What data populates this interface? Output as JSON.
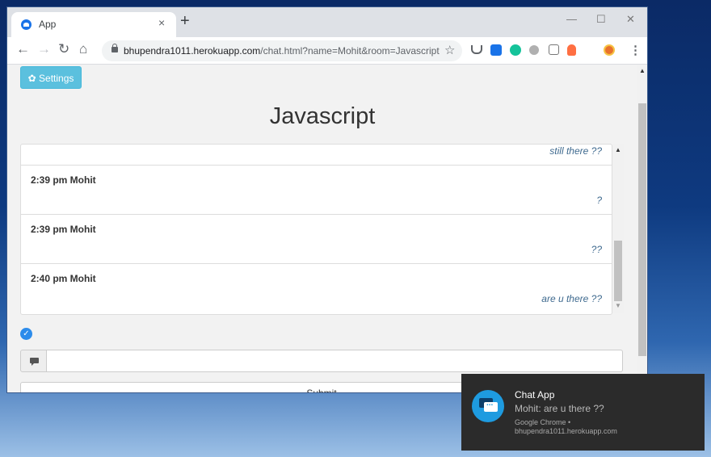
{
  "tab": {
    "title": "App",
    "close": "×",
    "new_tab": "+"
  },
  "window_controls": {
    "minimize": "—",
    "maximize": "☐",
    "close": "✕"
  },
  "toolbar": {
    "back": "←",
    "forward": "→",
    "reload": "↻",
    "home": "⌂",
    "url_domain": "bhupendra1011.herokuapp.com",
    "url_path": "/chat.html?name=Mohit&room=Javascript",
    "star": "☆",
    "menu": "⋮",
    "extensions": [
      "pocket-icon",
      "window-icon",
      "grammarly-icon",
      "settings-ext-icon",
      "translate-icon",
      "ghostery-icon",
      "profile-avatar"
    ]
  },
  "page": {
    "settings_label": "Settings",
    "room_title": "Javascript",
    "messages": [
      {
        "meta": "",
        "text": "still there ??"
      },
      {
        "meta": "2:39 pm Mohit",
        "text": "?"
      },
      {
        "meta": "2:39 pm Mohit",
        "text": "??"
      },
      {
        "meta": "2:40 pm Mohit",
        "text": "are u there ??"
      }
    ],
    "message_input": {
      "value": "",
      "placeholder": ""
    },
    "submit_label": "Submit"
  },
  "notification": {
    "title": "Chat App",
    "body": "Mohit: are u there ??",
    "source_line1": "Google Chrome •",
    "source_line2": "bhupendra1011.herokuapp.com"
  },
  "colors": {
    "accent": "#5bc0de",
    "message_text": "#3f6a8f",
    "toast_bg": "#2b2b2b"
  }
}
